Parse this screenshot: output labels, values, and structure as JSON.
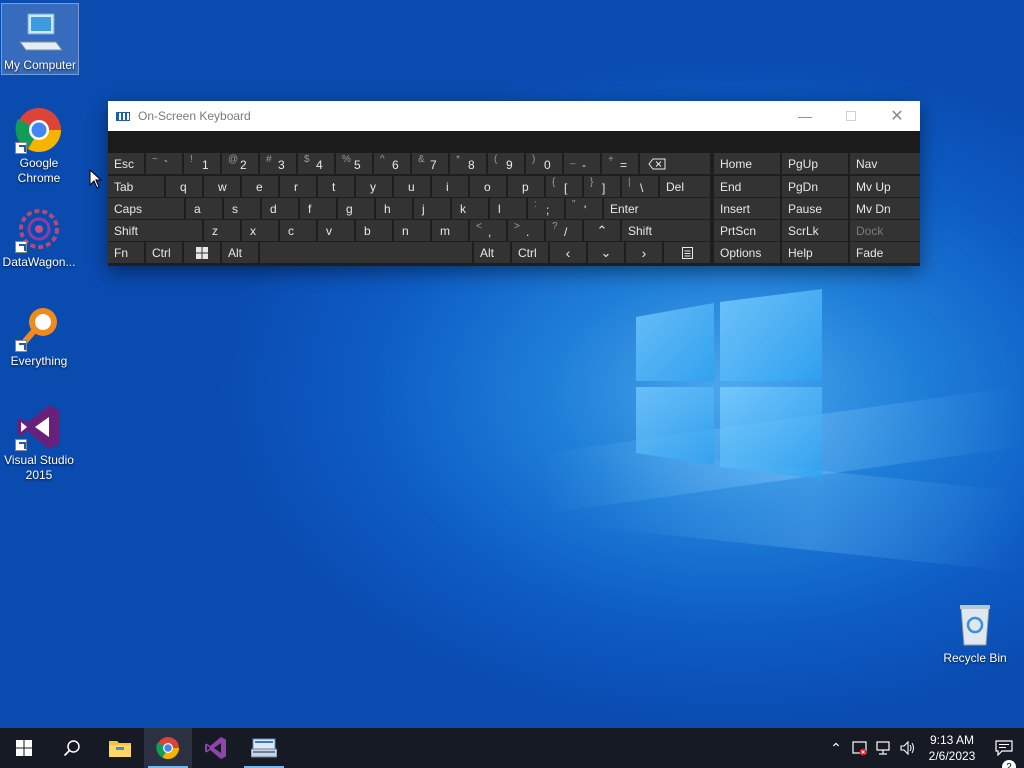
{
  "desktop": {
    "icons": [
      {
        "label": "My Computer"
      },
      {
        "label": "Google Chrome"
      },
      {
        "label": "DataWagon..."
      },
      {
        "label": "Everything"
      },
      {
        "label": "Visual Studio 2015"
      },
      {
        "label": "Recycle Bin"
      }
    ]
  },
  "osk": {
    "title": "On-Screen Keyboard",
    "row1": {
      "esc": "Esc",
      "k_tilde": {
        "shift": "~",
        "main": "`"
      },
      "k1": {
        "shift": "!",
        "main": "1"
      },
      "k2": {
        "shift": "@",
        "main": "2"
      },
      "k3": {
        "shift": "#",
        "main": "3"
      },
      "k4": {
        "shift": "$",
        "main": "4"
      },
      "k5": {
        "shift": "%",
        "main": "5"
      },
      "k6": {
        "shift": "^",
        "main": "6"
      },
      "k7": {
        "shift": "&",
        "main": "7"
      },
      "k8": {
        "shift": "*",
        "main": "8"
      },
      "k9": {
        "shift": "(",
        "main": "9"
      },
      "k0": {
        "shift": ")",
        "main": "0"
      },
      "kminus": {
        "shift": "_",
        "main": "-"
      },
      "kplus": {
        "shift": "+",
        "main": "="
      }
    },
    "row2": {
      "tab": "Tab",
      "letters": [
        "q",
        "w",
        "e",
        "r",
        "t",
        "y",
        "u",
        "i",
        "o",
        "p"
      ],
      "lbracket": {
        "shift": "{",
        "main": "["
      },
      "rbracket": {
        "shift": "}",
        "main": "]"
      },
      "backslash": {
        "shift": "|",
        "main": "\\"
      },
      "del": "Del"
    },
    "row3": {
      "caps": "Caps",
      "letters": [
        "a",
        "s",
        "d",
        "f",
        "g",
        "h",
        "j",
        "k",
        "l"
      ],
      "semicolon": {
        "shift": ":",
        "main": ";"
      },
      "quote": {
        "shift": "\"",
        "main": "'"
      },
      "enter": "Enter"
    },
    "row4": {
      "shift_left": "Shift",
      "letters": [
        "z",
        "x",
        "c",
        "v",
        "b",
        "n",
        "m"
      ],
      "comma": {
        "shift": "<",
        "main": ","
      },
      "period": {
        "shift": ">",
        "main": "."
      },
      "slash": {
        "shift": "?",
        "main": "/"
      },
      "shift_right": "Shift"
    },
    "row5": {
      "fn": "Fn",
      "ctrl_left": "Ctrl",
      "alt_left": "Alt",
      "alt_right": "Alt",
      "ctrl_right": "Ctrl"
    },
    "nav": {
      "home": "Home",
      "pgup": "PgUp",
      "nav": "Nav",
      "end": "End",
      "pgdn": "PgDn",
      "mvup": "Mv Up",
      "insert": "Insert",
      "pause": "Pause",
      "mvdn": "Mv Dn",
      "prtscn": "PrtScn",
      "scrlk": "ScrLk",
      "dock": "Dock",
      "options": "Options",
      "help": "Help",
      "fade": "Fade"
    }
  },
  "taskbar": {
    "clock_time": "9:13 AM",
    "clock_date": "2/6/2023",
    "notification_count": "2"
  },
  "colors": {
    "taskbar": "#151a24",
    "key": "#333333",
    "osk_bg": "#1e1e1e",
    "accent": "#76b9ed"
  }
}
